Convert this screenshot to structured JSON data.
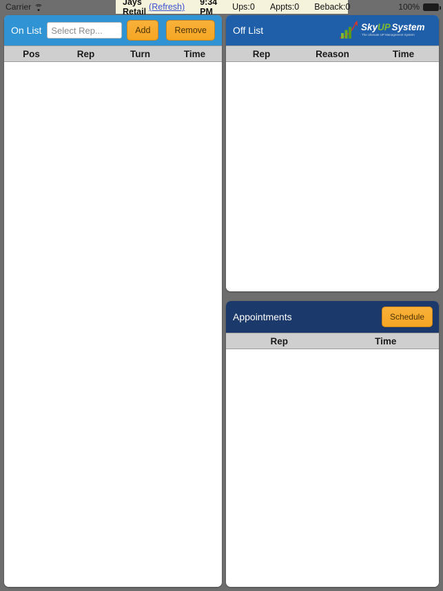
{
  "status_bar": {
    "carrier": "Carrier",
    "wifi_icon": "wifi-icon",
    "app_name": "Jays Retail",
    "refresh_label": "(Refresh)",
    "time": "9:34 PM",
    "ups": "Ups:0",
    "appts": "Appts:0",
    "beback": "Beback:0",
    "battery_percent": "100%",
    "battery_icon": "battery-full-icon"
  },
  "panels": {
    "on_list": {
      "title": "On List",
      "select_rep_placeholder": "Select Rep...",
      "add_label": "Add",
      "remove_label": "Remove",
      "columns": [
        "Pos",
        "Rep",
        "Turn",
        "Time"
      ],
      "rows": []
    },
    "off_list": {
      "title": "Off List",
      "logo_text": "SkyUPSystem",
      "logo_tagline": "The Ultimate UP Management System",
      "columns": [
        "Rep",
        "Reason",
        "Time"
      ],
      "rows": []
    },
    "appointments": {
      "title": "Appointments",
      "schedule_label": "Schedule",
      "columns": [
        "Rep",
        "Time"
      ],
      "rows": []
    }
  },
  "colors": {
    "background": "#6e6e6e",
    "on_list_header": "#2f93d4",
    "off_list_header": "#1f5fa9",
    "appointments_header": "#1b3a6b",
    "button_orange": "#f5a623",
    "column_header_gray": "#cfcfcf",
    "status_center_bg": "#f5f3dc",
    "refresh_link": "#3a4fd0"
  }
}
